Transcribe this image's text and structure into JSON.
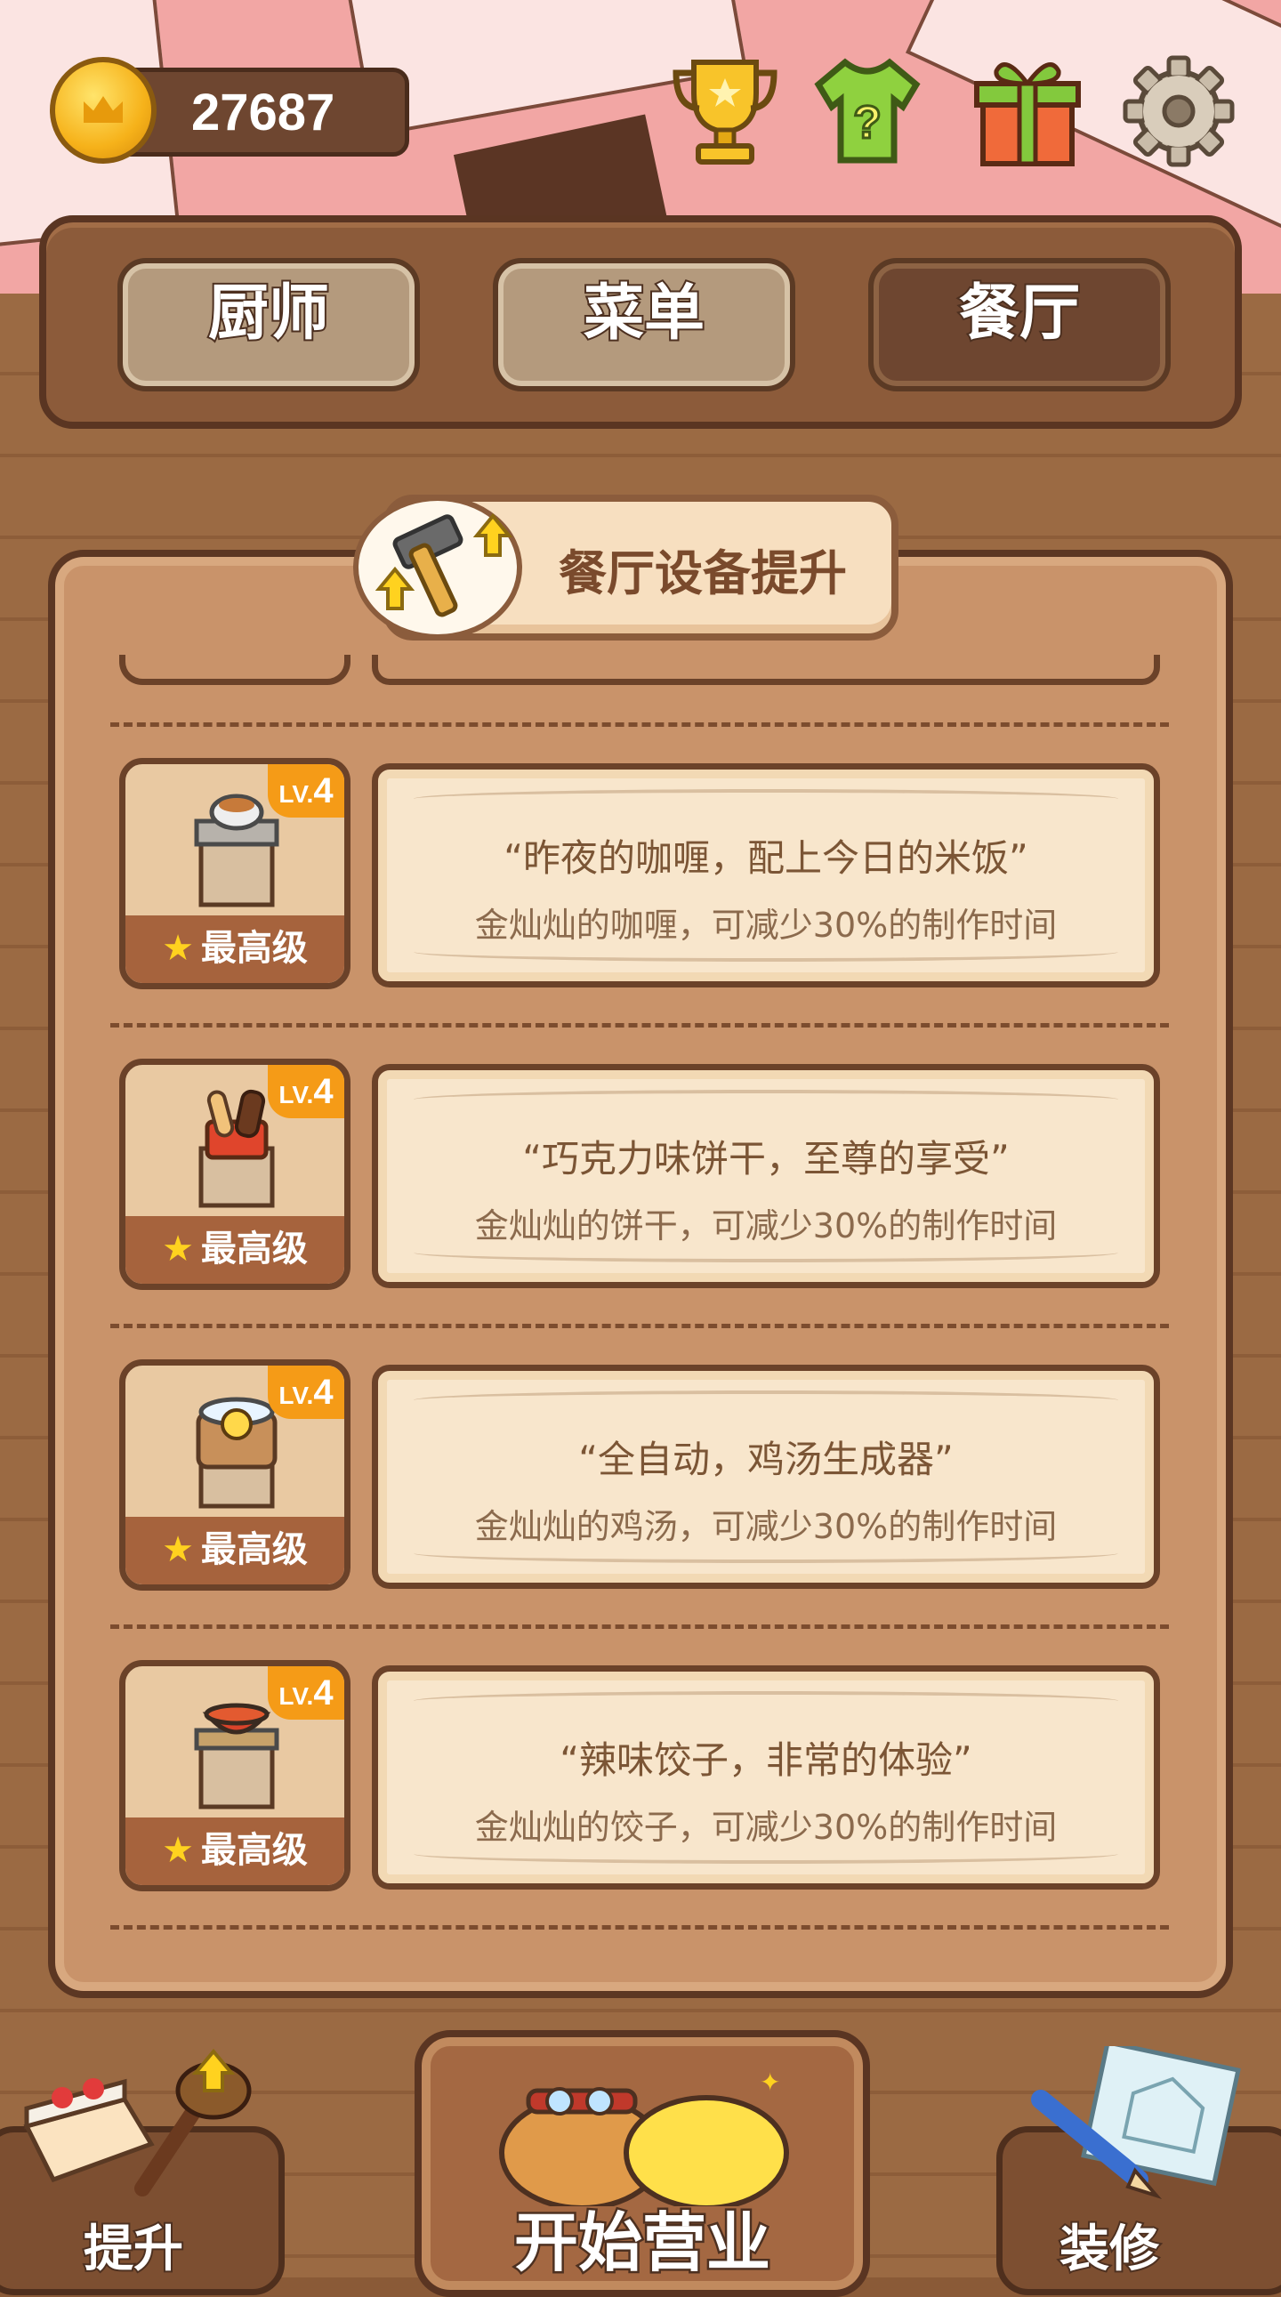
{
  "coins": {
    "value": "27687"
  },
  "top_icons": [
    "trophy-icon",
    "mystery-shirt-icon",
    "gift-icon",
    "gear-icon"
  ],
  "tabs": [
    {
      "label": "厨师",
      "active": false
    },
    {
      "label": "菜单",
      "active": false
    },
    {
      "label": "餐厅",
      "active": true
    }
  ],
  "panel": {
    "title": "餐厅设备提升"
  },
  "equipment": [
    {
      "level_prefix": "LV.",
      "level": "4",
      "status": "最高级",
      "quote": "“昨夜的咖喱，配上今日的米饭”",
      "desc": "金灿灿的咖喱，可减少30%的制作时间",
      "icon": "curry-pot-icon"
    },
    {
      "level_prefix": "LV.",
      "level": "4",
      "status": "最高级",
      "quote": "“巧克力味饼干，至尊的享受”",
      "desc": "金灿灿的饼干，可减少30%的制作时间",
      "icon": "chocolate-biscuit-icon"
    },
    {
      "level_prefix": "LV.",
      "level": "4",
      "status": "最高级",
      "quote": "“全自动，鸡汤生成器”",
      "desc": "金灿灿的鸡汤，可减少30%的制作时间",
      "icon": "chicken-soup-machine-icon"
    },
    {
      "level_prefix": "LV.",
      "level": "4",
      "status": "最高级",
      "quote": "“辣味饺子，非常的体验”",
      "desc": "金灿灿的饺子，可减少30%的制作时间",
      "icon": "spicy-dumpling-pot-icon"
    }
  ],
  "bottom": {
    "upgrade_label": "提升",
    "start_label": "开始营业",
    "decorate_label": "装修"
  },
  "colors": {
    "coin": "#f6b21a",
    "level_badge": "#f59b17",
    "star": "#ffd21f",
    "backdrop": "#f2a6a4"
  }
}
